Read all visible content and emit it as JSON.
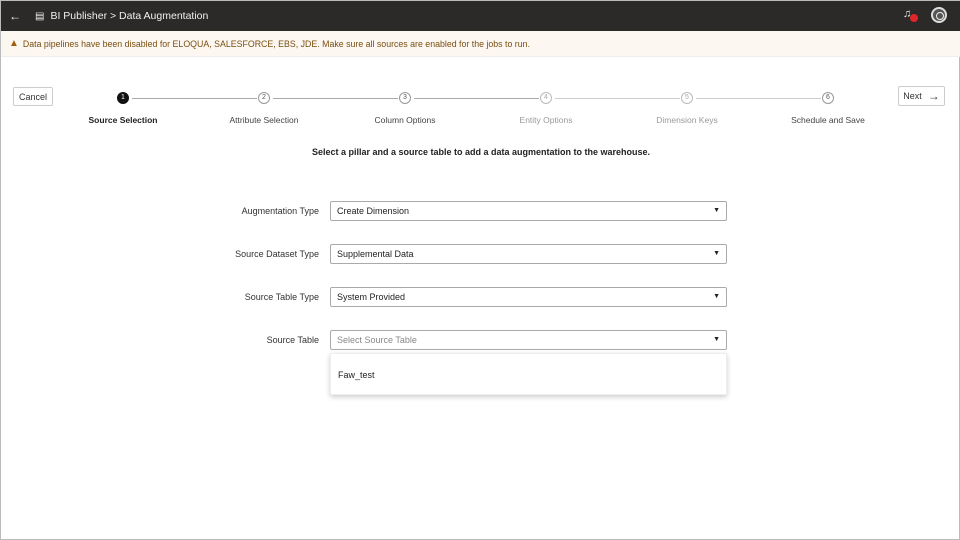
{
  "header": {
    "back_icon": "arrow-left",
    "doc_icon": "document-icon",
    "breadcrumb": "BI Publisher > Data Augmentation"
  },
  "banner": {
    "text": "Data pipelines have been disabled for ELOQUA, SALESFORCE, EBS, JDE. Make sure all sources are enabled for the jobs to run."
  },
  "buttons": {
    "cancel": "Cancel",
    "next": "Next",
    "next_icon": "→"
  },
  "steps": [
    {
      "num": "1",
      "label": "Source Selection",
      "state": "active"
    },
    {
      "num": "2",
      "label": "Attribute Selection",
      "state": "enabled"
    },
    {
      "num": "3",
      "label": "Column Options",
      "state": "enabled"
    },
    {
      "num": "4",
      "label": "Entity Options",
      "state": "disabled"
    },
    {
      "num": "5",
      "label": "Dimension Keys",
      "state": "disabled"
    },
    {
      "num": "6",
      "label": "Schedule and Save",
      "state": "enabled"
    }
  ],
  "instruction": "Select a pillar and a source table to add a data augmentation to the warehouse.",
  "form": [
    {
      "label": "Augmentation Type",
      "value": "Create Dimension"
    },
    {
      "label": "Source Dataset Type",
      "value": "Supplemental Data"
    },
    {
      "label": "Source Table Type",
      "value": "System Provided"
    },
    {
      "label": "Source Table",
      "placeholder": "Select Source Table"
    }
  ],
  "dropdown_options": [
    "Faw_test"
  ]
}
